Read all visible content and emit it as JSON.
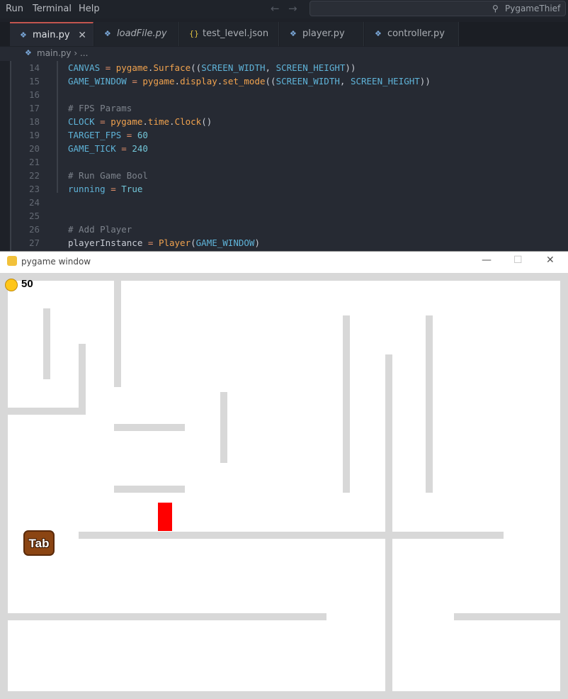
{
  "menubar": {
    "items": [
      "Run",
      "Terminal",
      "Help"
    ],
    "search_label": "PygameThief"
  },
  "tabs": [
    {
      "label": "main.py",
      "icon": "python-file-icon",
      "active": true,
      "italic": false
    },
    {
      "label": "loadFile.py",
      "icon": "python-file-icon",
      "active": false,
      "italic": true
    },
    {
      "label": "test_level.json",
      "icon": "json-file-icon",
      "active": false,
      "italic": false
    },
    {
      "label": "player.py",
      "icon": "python-file-icon",
      "active": false,
      "italic": false
    },
    {
      "label": "controller.py",
      "icon": "python-file-icon",
      "active": false,
      "italic": false
    }
  ],
  "breadcrumb": {
    "file": "main.py",
    "rest": "..."
  },
  "code_lines": [
    {
      "n": "14",
      "text": "CANVAS = pygame.Surface((SCREEN_WIDTH, SCREEN_HEIGHT))"
    },
    {
      "n": "15",
      "text": "GAME_WINDOW = pygame.display.set_mode((SCREEN_WIDTH, SCREEN_HEIGHT))"
    },
    {
      "n": "16",
      "text": ""
    },
    {
      "n": "17",
      "text": "# FPS Params"
    },
    {
      "n": "18",
      "text": "CLOCK = pygame.time.Clock()"
    },
    {
      "n": "19",
      "text": "TARGET_FPS = 60"
    },
    {
      "n": "20",
      "text": "GAME_TICK = 240"
    },
    {
      "n": "21",
      "text": ""
    },
    {
      "n": "22",
      "text": "# Run Game Bool"
    },
    {
      "n": "23",
      "text": "running = True"
    },
    {
      "n": "24",
      "text": ""
    },
    {
      "n": "25",
      "text": ""
    },
    {
      "n": "26",
      "text": "# Add Player"
    },
    {
      "n": "27",
      "text": "playerInstance = Player(GAME_WINDOW)"
    }
  ],
  "pygame_window": {
    "title": "pygame window",
    "coin_count": "50",
    "tab_key_label": "Tab",
    "controls": {
      "minimize": "—",
      "maximize": "☐",
      "close": "✕"
    }
  },
  "colors": {
    "editor_bg": "#262a33",
    "wall": "#d8d8d8",
    "player": "#ff0000",
    "coin": "#ffc619"
  }
}
